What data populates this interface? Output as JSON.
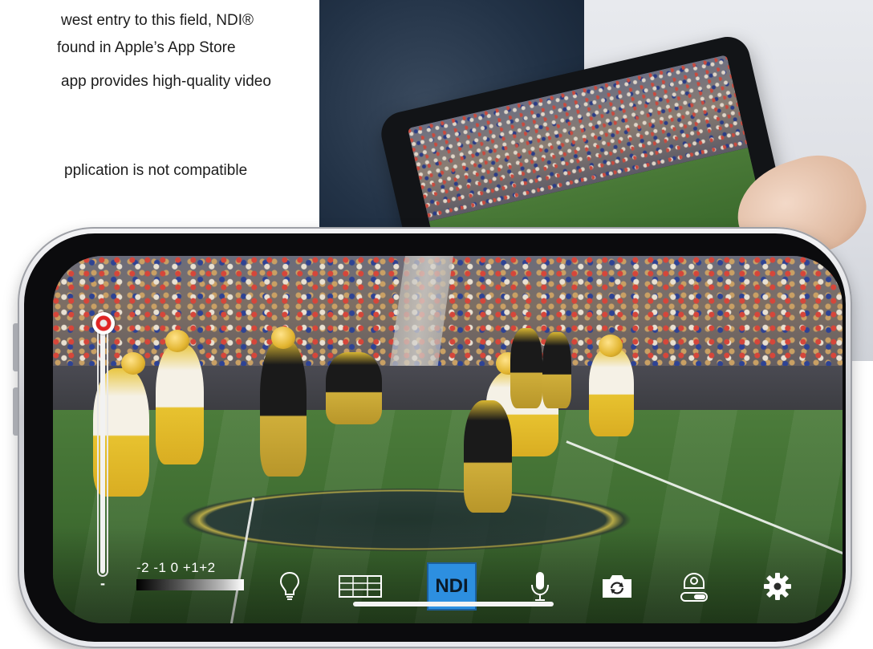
{
  "document": {
    "lines": [
      "west entry to this field, NDI®",
      " found in Apple’s App Store",
      "app provides high-quality video",
      "pplication is not compatible"
    ]
  },
  "camera_ui": {
    "exposure_minus": "-",
    "ev_scale": "-2  -1  0  +1+2",
    "ndi_label": "NDI",
    "icons": [
      "lightbulb-icon",
      "grid-icon",
      "ndi-icon",
      "microphone-icon",
      "camera-flip-icon",
      "pan-tilt-camera-icon",
      "gear-icon"
    ]
  },
  "colors": {
    "ndi_active": "#2d8fe0",
    "exposure_knob": "#e02424",
    "ui_foreground": "#ffffff"
  }
}
